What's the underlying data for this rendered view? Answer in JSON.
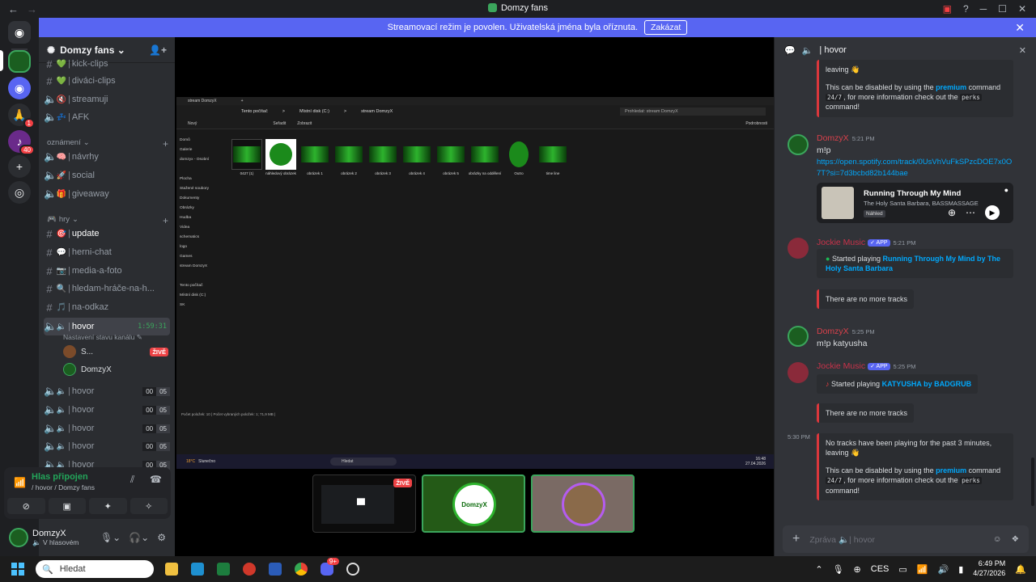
{
  "window": {
    "title": "Domzy fans",
    "back_glyph": "←",
    "forward_glyph": "→"
  },
  "banner": {
    "text": "Streamovací režim je povolen. Uživatelská jména byla oříznuta.",
    "button": "Zakázat"
  },
  "servers": {
    "badges": [
      "1",
      "40"
    ]
  },
  "guild": {
    "name": "Domzy fans ⌄"
  },
  "channels": {
    "top": [
      {
        "emoji": "💚",
        "name": "kick-clips"
      },
      {
        "emoji": "💚",
        "name": "diváci-clips"
      },
      {
        "emoji": "🔇",
        "name": "streamuji"
      },
      {
        "emoji": "💤",
        "name": "AFK"
      }
    ],
    "cat_oznameni": "oznámení",
    "oznameni": [
      {
        "emoji": "🧠",
        "name": "návrhy"
      },
      {
        "emoji": "🚀",
        "name": "social"
      },
      {
        "emoji": "🎁",
        "name": "giveaway"
      }
    ],
    "cat_hry": "hry",
    "hry": [
      {
        "emoji": "🎯",
        "name": "update"
      },
      {
        "emoji": "💬",
        "name": "herni-chat"
      },
      {
        "emoji": "📷",
        "name": "media-a-foto"
      },
      {
        "emoji": "🔍",
        "name": "hledam-hráče-na-h..."
      },
      {
        "emoji": "🎵",
        "name": "na-odkaz"
      }
    ],
    "active_voice": {
      "name": "hovor",
      "timer": "1:59:31",
      "status": "Nastavení stavu kanálu"
    },
    "voice_users": [
      {
        "name": "S...",
        "live": "ŽIVĚ"
      },
      {
        "name": "DomzyX"
      }
    ],
    "other_voice": [
      {
        "name": "hovor",
        "a": "00",
        "b": "05"
      },
      {
        "name": "hovor",
        "a": "00",
        "b": "05"
      },
      {
        "name": "hovor",
        "a": "00",
        "b": "05"
      },
      {
        "name": "hovor",
        "a": "00",
        "b": "05"
      },
      {
        "name": "hovor",
        "a": "00",
        "b": "05"
      }
    ]
  },
  "voice_panel": {
    "status": "Hlas připojen",
    "location": "/ hovor / Domzy fans"
  },
  "user": {
    "name": "DomzyX",
    "status": "V hlasovém"
  },
  "stream": {
    "explorer": {
      "tab": "stream DomzyX",
      "add_tab": "+",
      "path": [
        "Tento počítač",
        ">",
        "Místní disk (C:)",
        ">",
        "stream DomzyX"
      ],
      "search": "Prohledat: stream DomzyX",
      "toolbar": [
        "Nový",
        "Seřadit",
        "Zobrazit",
        "Podrobnosti"
      ],
      "sidebar": [
        "Domů",
        "Galerie",
        "domzyx - Osobní",
        "",
        "Plocha",
        "Stažené soubory",
        "Dokumenty",
        "Obrázky",
        "Hudba",
        "Videa",
        "schematics",
        "logo",
        "Games",
        "stream DomzyX",
        "",
        "Tento počítač",
        "Místní disk (C:)",
        "SK"
      ],
      "files": [
        "0427 (1)",
        "náhledový obrázek",
        "obrázek 1",
        "obrázek 2",
        "obrázek 3",
        "obrázek 4",
        "obrázek 5",
        "obrázky na oddělení",
        "Outro",
        "time line"
      ],
      "status": "Počet položek: 10 | Počet vybraných položek: 1; 71,9 MB |"
    },
    "inner_taskbar": {
      "weather_temp": "18°C",
      "weather": "Slunečno",
      "search": "Hledat",
      "time": "16:48",
      "date": "27.04.2026"
    },
    "tile_live": "ŽIVĚ",
    "tile_logo_text": "DomzyX"
  },
  "chat": {
    "header": "hovor",
    "top_embed": {
      "line1": "leaving 👋",
      "pre": "This can be disabled by using the",
      "premium": "premium",
      "cmd": "command",
      "code1": "24/7",
      "mid": ", for more information check out the",
      "code2": "perks",
      "end": "command!"
    },
    "msg1": {
      "author": "DomzyX",
      "time": "5:21 PM",
      "text": "m!p",
      "link": "https://open.spotify.com/track/0UsVhVuFkSPzcDOE7x0O7T?si=7d3bcbd82b144bae"
    },
    "spotify": {
      "title": "Running Through My Mind",
      "artist": "The Holy Santa Barbara, BASSMASSAGE",
      "preview": "Náhled",
      "dots": "⋯",
      "accent": "#1db954"
    },
    "msg2": {
      "author": "Jockie Music",
      "app": "✓ APP",
      "time": "5:21 PM",
      "started": "Started playing",
      "track": "Running Through My Mind by The Holy Santa Barbara",
      "nomore": "There are no more tracks"
    },
    "msg3": {
      "author": "DomzyX",
      "time": "5:25 PM",
      "text": "m!p katyusha"
    },
    "msg4": {
      "author": "Jockie Music",
      "app": "✓ APP",
      "time": "5:25 PM",
      "started": "Started playing",
      "track": "KATYUSHA by BADGRUB",
      "nomore": "There are no more tracks"
    },
    "msg5": {
      "time": "5:30 PM",
      "line1": "No tracks have been playing for the past 3 minutes,",
      "line2": "leaving 👋",
      "pre": "This can be disabled by using the",
      "premium": "premium",
      "cmd": "command",
      "code1": "24/7",
      "mid": ", for more information check out the",
      "code2": "perks",
      "end": "command!"
    },
    "composer_placeholder": "Zpráva",
    "composer_channel": "hovor",
    "name_colors": {
      "domzy": "#d9414b",
      "jockie": "#c9334a"
    }
  },
  "taskbar": {
    "search": "Hledat",
    "lang": "CES",
    "time": "6:49 PM",
    "date": "4/27/2026",
    "discord_badge": "9+"
  }
}
